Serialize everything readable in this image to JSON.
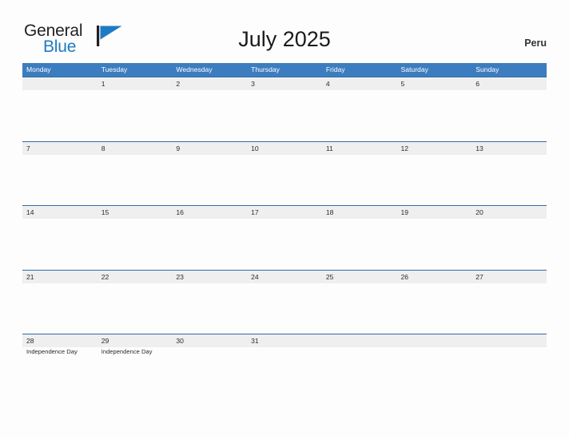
{
  "logo": {
    "word_one": "General",
    "word_two": "Blue",
    "flag_icon": "flag-triangle-icon",
    "flag_color": "#1f7ac4",
    "pole_color": "#231f20"
  },
  "header": {
    "title": "July 2025",
    "country": "Peru"
  },
  "colors": {
    "header_row_bg": "#3c7dbf",
    "date_strip_bg": "#efefef",
    "row_divider": "#2e6da8",
    "page_bg": "#fdfdfd",
    "text": "#2b2b2b"
  },
  "calendar": {
    "weekdays": [
      "Monday",
      "Tuesday",
      "Wednesday",
      "Thursday",
      "Friday",
      "Saturday",
      "Sunday"
    ],
    "weeks": [
      [
        {
          "day": "",
          "events": []
        },
        {
          "day": "1",
          "events": []
        },
        {
          "day": "2",
          "events": []
        },
        {
          "day": "3",
          "events": []
        },
        {
          "day": "4",
          "events": []
        },
        {
          "day": "5",
          "events": []
        },
        {
          "day": "6",
          "events": []
        }
      ],
      [
        {
          "day": "7",
          "events": []
        },
        {
          "day": "8",
          "events": []
        },
        {
          "day": "9",
          "events": []
        },
        {
          "day": "10",
          "events": []
        },
        {
          "day": "11",
          "events": []
        },
        {
          "day": "12",
          "events": []
        },
        {
          "day": "13",
          "events": []
        }
      ],
      [
        {
          "day": "14",
          "events": []
        },
        {
          "day": "15",
          "events": []
        },
        {
          "day": "16",
          "events": []
        },
        {
          "day": "17",
          "events": []
        },
        {
          "day": "18",
          "events": []
        },
        {
          "day": "19",
          "events": []
        },
        {
          "day": "20",
          "events": []
        }
      ],
      [
        {
          "day": "21",
          "events": []
        },
        {
          "day": "22",
          "events": []
        },
        {
          "day": "23",
          "events": []
        },
        {
          "day": "24",
          "events": []
        },
        {
          "day": "25",
          "events": []
        },
        {
          "day": "26",
          "events": []
        },
        {
          "day": "27",
          "events": []
        }
      ],
      [
        {
          "day": "28",
          "events": [
            "Independence Day"
          ]
        },
        {
          "day": "29",
          "events": [
            "Independence Day"
          ]
        },
        {
          "day": "30",
          "events": []
        },
        {
          "day": "31",
          "events": []
        },
        {
          "day": "",
          "events": []
        },
        {
          "day": "",
          "events": []
        },
        {
          "day": "",
          "events": []
        }
      ]
    ]
  }
}
